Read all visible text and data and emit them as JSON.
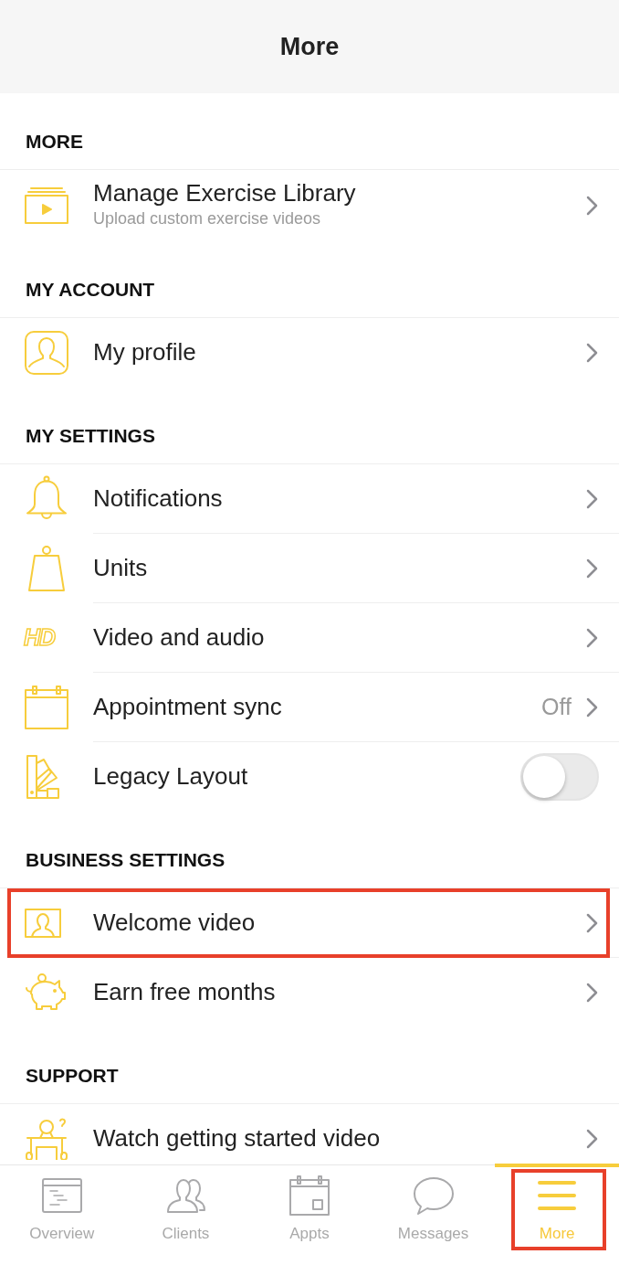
{
  "header": {
    "title": "More"
  },
  "sections": [
    {
      "title": "MORE",
      "items": [
        {
          "kind": "link",
          "label": "Manage Exercise Library",
          "subtitle": "Upload custom exercise videos",
          "highlighted": false
        }
      ]
    },
    {
      "title": "MY ACCOUNT",
      "items": [
        {
          "kind": "link",
          "label": "My profile",
          "highlighted": false
        }
      ]
    },
    {
      "title": "MY SETTINGS",
      "items": [
        {
          "kind": "link",
          "label": "Notifications",
          "highlighted": false
        },
        {
          "kind": "link",
          "label": "Units",
          "highlighted": false
        },
        {
          "kind": "link",
          "label": "Video and audio",
          "badge": "HD",
          "highlighted": false
        },
        {
          "kind": "link",
          "label": "Appointment sync",
          "value": "Off",
          "highlighted": false
        },
        {
          "kind": "toggle",
          "label": "Legacy Layout",
          "on": false,
          "highlighted": false
        }
      ]
    },
    {
      "title": "BUSINESS SETTINGS",
      "items": [
        {
          "kind": "link",
          "label": "Welcome video",
          "highlighted": true
        },
        {
          "kind": "link",
          "label": "Earn free months",
          "highlighted": false
        }
      ]
    },
    {
      "title": "SUPPORT",
      "items": [
        {
          "kind": "link",
          "label": "Watch getting started video",
          "highlighted": false
        }
      ]
    }
  ],
  "tab_bar": [
    {
      "label": "Overview",
      "selected": false,
      "highlighted": false
    },
    {
      "label": "Clients",
      "selected": false,
      "highlighted": false
    },
    {
      "label": "Appts",
      "selected": false,
      "highlighted": false
    },
    {
      "label": "Messages",
      "selected": false,
      "highlighted": false
    },
    {
      "label": "More",
      "selected": true,
      "highlighted": true
    }
  ]
}
